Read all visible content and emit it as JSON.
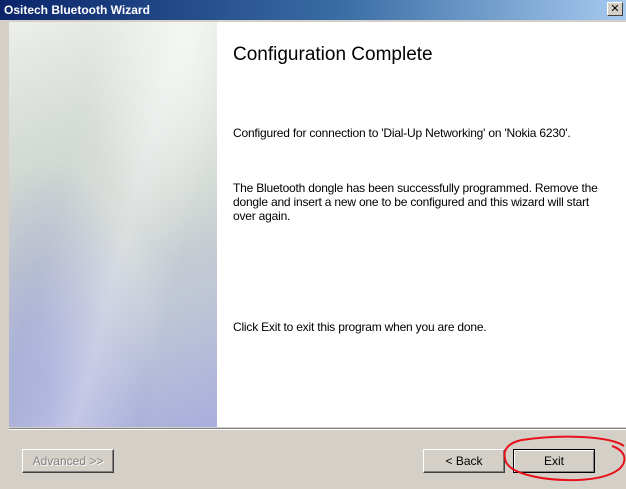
{
  "window": {
    "title": "Ositech Bluetooth Wizard",
    "close_glyph": "✕"
  },
  "main": {
    "heading": "Configuration Complete",
    "paragraphs": [
      "Configured for connection to 'Dial-Up Networking' on 'Nokia 6230'.",
      "The Bluetooth dongle has been successfully programmed. Remove the dongle and insert a new one to be configured and this wizard will start over again.",
      "Click Exit to exit this program when you are done."
    ]
  },
  "footer": {
    "advanced_label": "Advanced >>",
    "back_label": "< Back",
    "exit_label": "Exit"
  },
  "colors": {
    "title_bar_start": "#0a246a",
    "title_bar_end": "#a6caf0",
    "window_face": "#d4d0c8",
    "annotation_red": "#e8101a"
  },
  "icons": {
    "close": "close-icon",
    "annotation": "red-circle-annotation"
  }
}
